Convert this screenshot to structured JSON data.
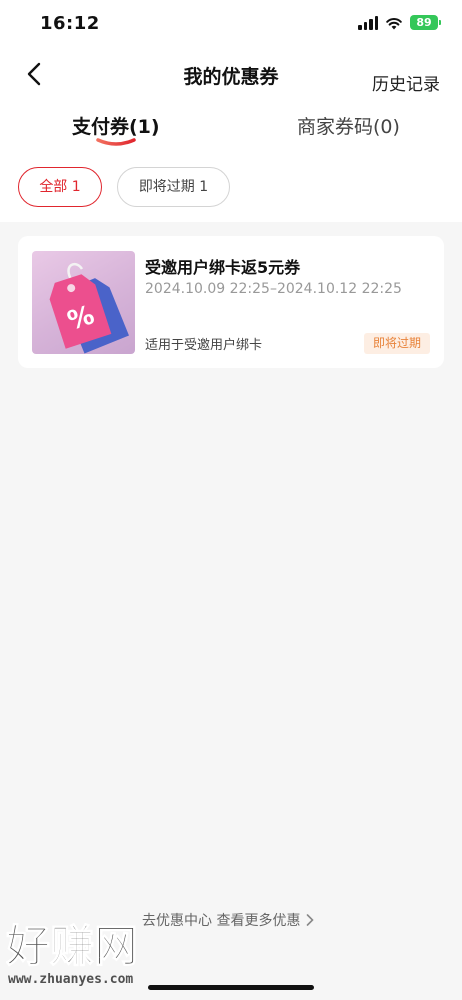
{
  "status_bar": {
    "time": "16:12",
    "battery": "89"
  },
  "nav": {
    "title": "我的优惠券",
    "history_label": "历史记录"
  },
  "tabs": {
    "pay": "支付券(1)",
    "merchant": "商家券码(0)"
  },
  "filters": {
    "all": "全部 1",
    "expiring": "即将过期 1"
  },
  "coupon": {
    "title": "受邀用户绑卡返5元券",
    "validity": "2024.10.09 22:25–2024.10.12 22:25",
    "scope": "适用于受邀用户绑卡",
    "badge": "即将过期"
  },
  "footer": {
    "more_label": "去优惠中心 查看更多优惠"
  },
  "watermark": {
    "main": "好赚网",
    "sub": "www.zhuanyes.com"
  },
  "colors": {
    "accent": "#e0262e",
    "badge_text": "#e8833a",
    "badge_bg": "#fdeee3"
  }
}
